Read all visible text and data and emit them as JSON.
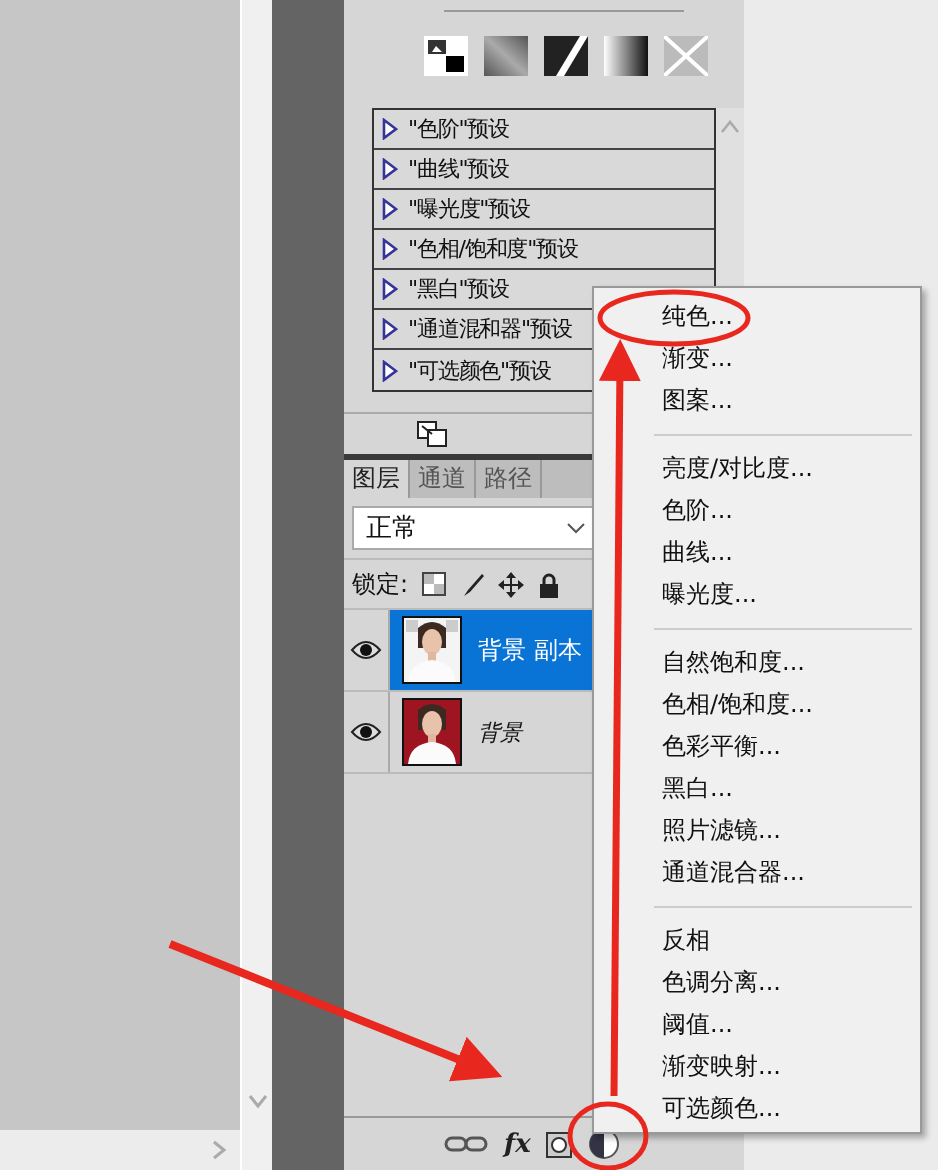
{
  "presets": [
    {
      "label": "\"色阶\"预设"
    },
    {
      "label": "\"曲线\"预设"
    },
    {
      "label": "\"曝光度\"预设"
    },
    {
      "label": "\"色相/饱和度\"预设"
    },
    {
      "label": "\"黑白\"预设"
    },
    {
      "label": "\"通道混和器\"预设"
    },
    {
      "label": "\"可选颜色\"预设"
    }
  ],
  "layers_panel": {
    "tabs": [
      {
        "label": "图层",
        "selected": true
      },
      {
        "label": "通道",
        "selected": false
      },
      {
        "label": "路径",
        "selected": false
      }
    ],
    "blend_mode": "正常",
    "lock_label": "锁定:",
    "layers": [
      {
        "name": "背景 副本",
        "kind": "copy",
        "selected": true,
        "visible": true
      },
      {
        "name": "背景",
        "kind": "background",
        "selected": false,
        "visible": true
      }
    ],
    "fx_label": "fx"
  },
  "menu": {
    "groups": [
      [
        "纯色...",
        "渐变...",
        "图案..."
      ],
      [
        "亮度/对比度...",
        "色阶...",
        "曲线...",
        "曝光度..."
      ],
      [
        "自然饱和度...",
        "色相/饱和度...",
        "色彩平衡...",
        "黑白...",
        "照片滤镜...",
        "通道混合器..."
      ],
      [
        "反相",
        "色调分离...",
        "阈值...",
        "渐变映射...",
        "可选颜色..."
      ]
    ]
  }
}
